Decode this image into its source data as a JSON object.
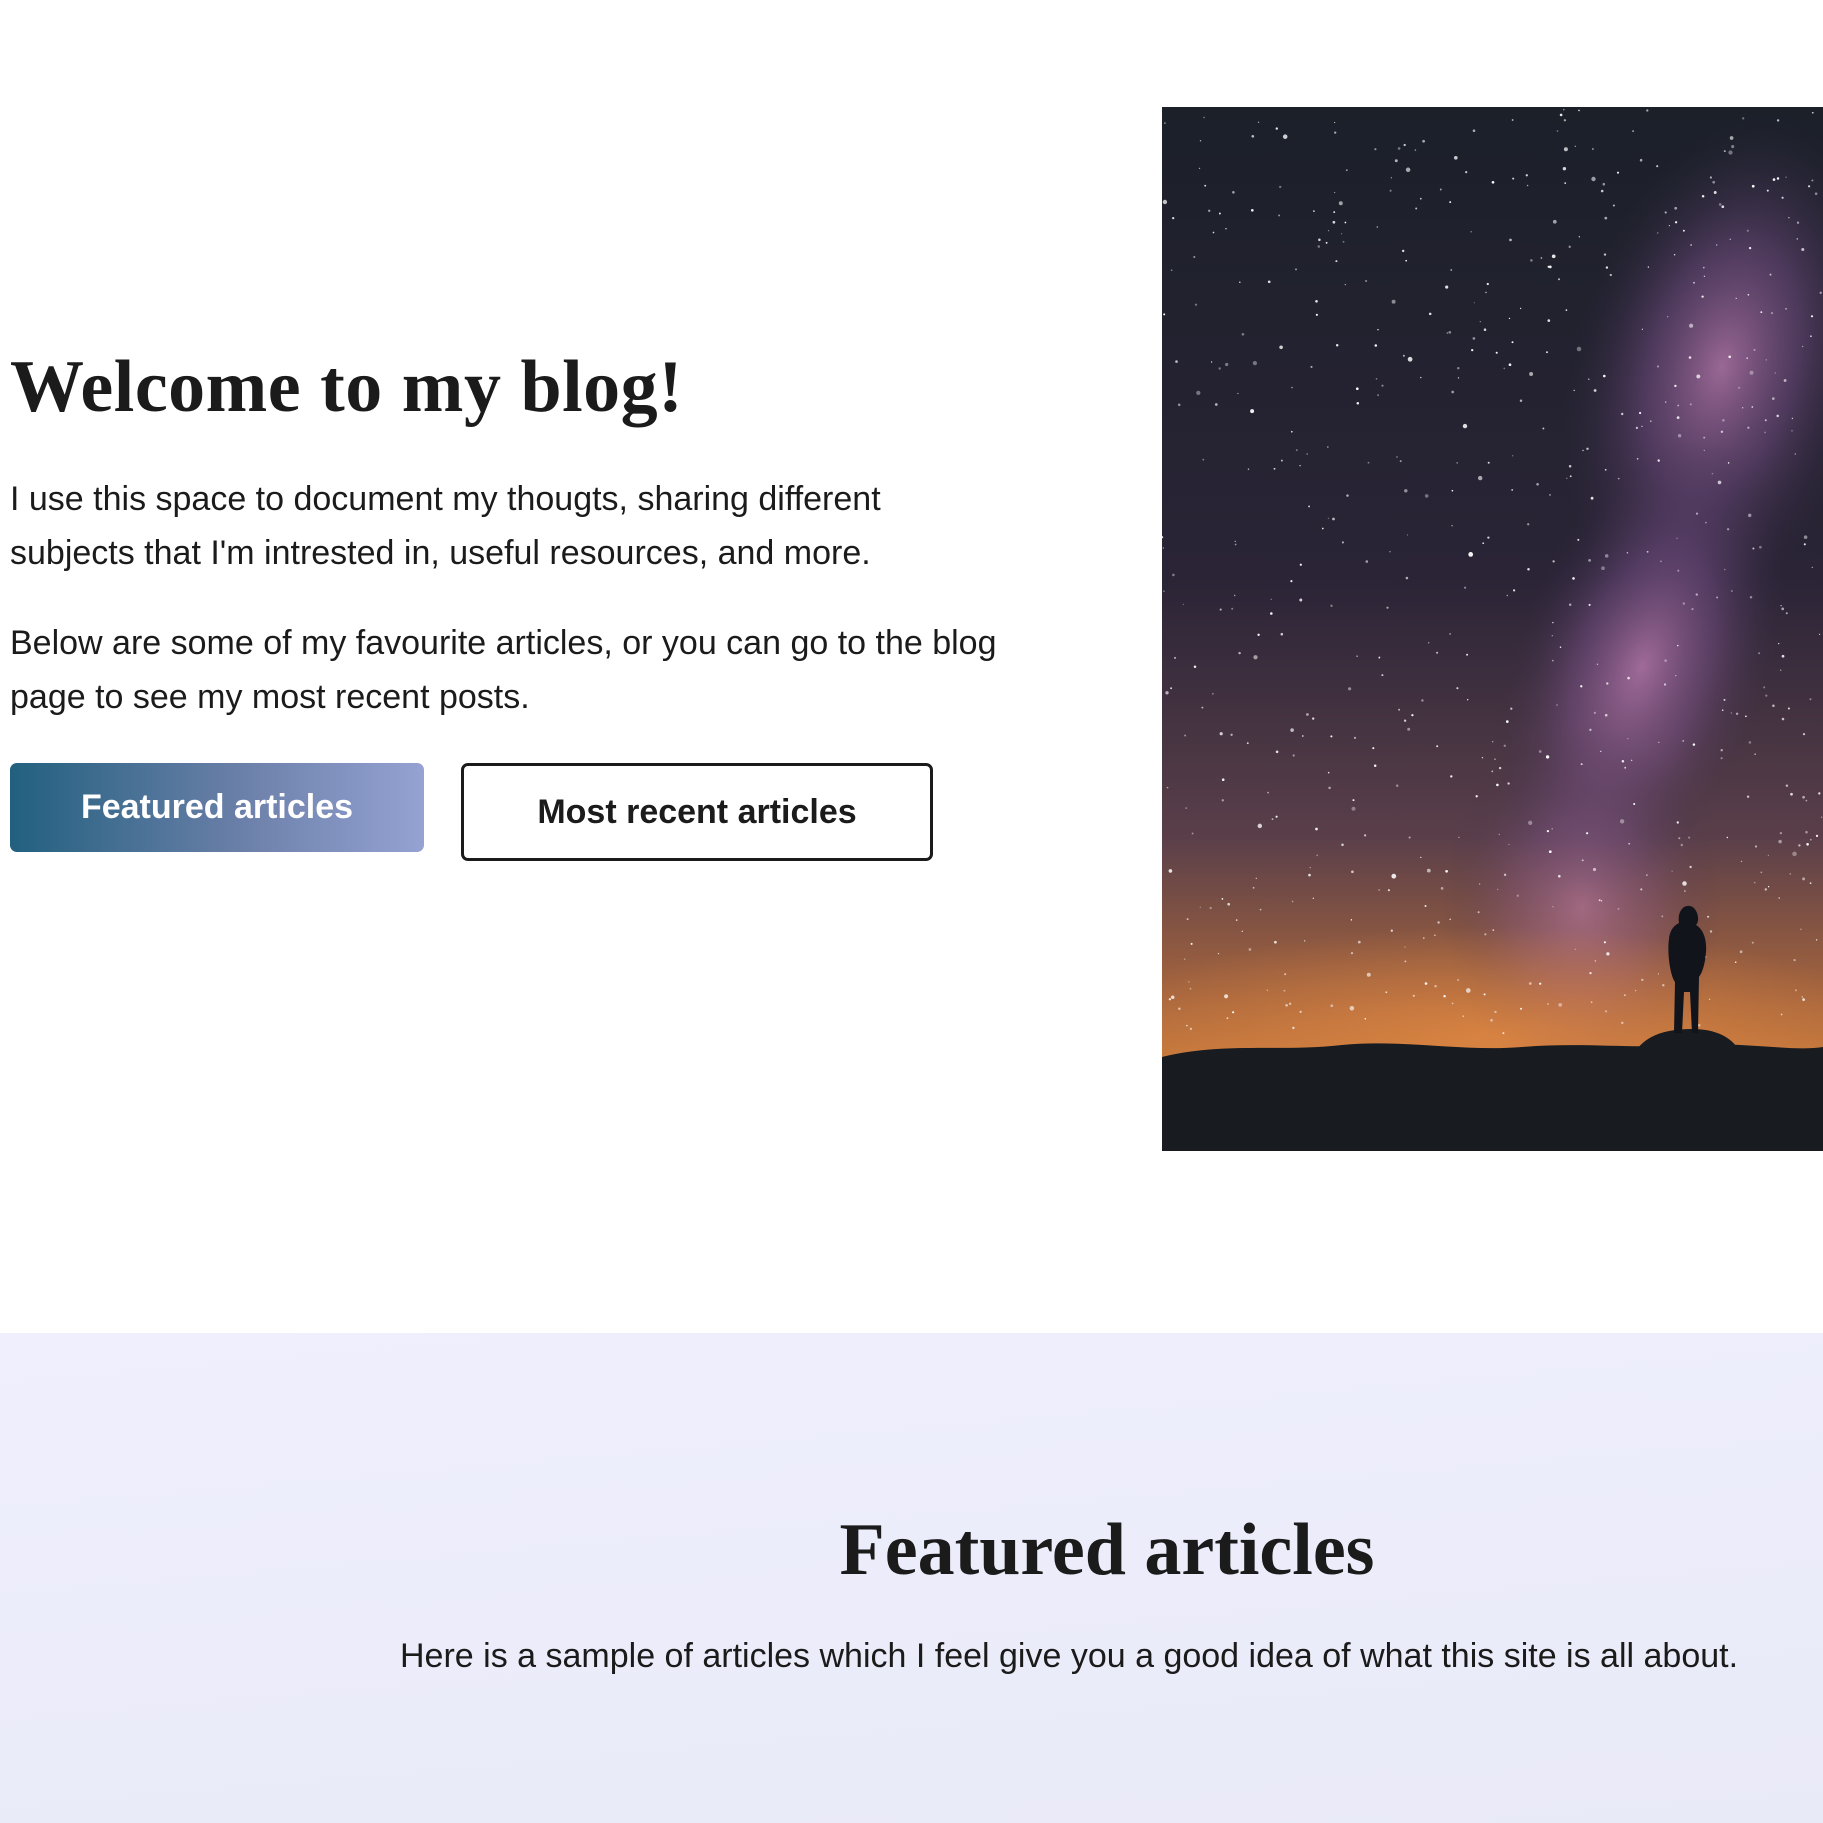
{
  "hero": {
    "title": "Welcome to my blog!",
    "paragraph1": "I use this space to document my thougts, sharing different subjects that I'm intrested in, useful resources, and more.",
    "paragraph2": "Below are some of my favourite articles, or you can go to the blog page to see my most recent posts.",
    "primary_button": "Featured articles",
    "secondary_button": "Most recent articles",
    "image_icon": "night-sky-milky-way-image"
  },
  "featured": {
    "title": "Featured articles",
    "subtitle": "Here is a sample of articles which I feel give you a good idea of what this site is all about."
  },
  "colors": {
    "text": "#1b1b1b",
    "button_gradient_start": "#22607f",
    "button_gradient_end": "#95a2d3",
    "featured_background": "#efeffd"
  }
}
